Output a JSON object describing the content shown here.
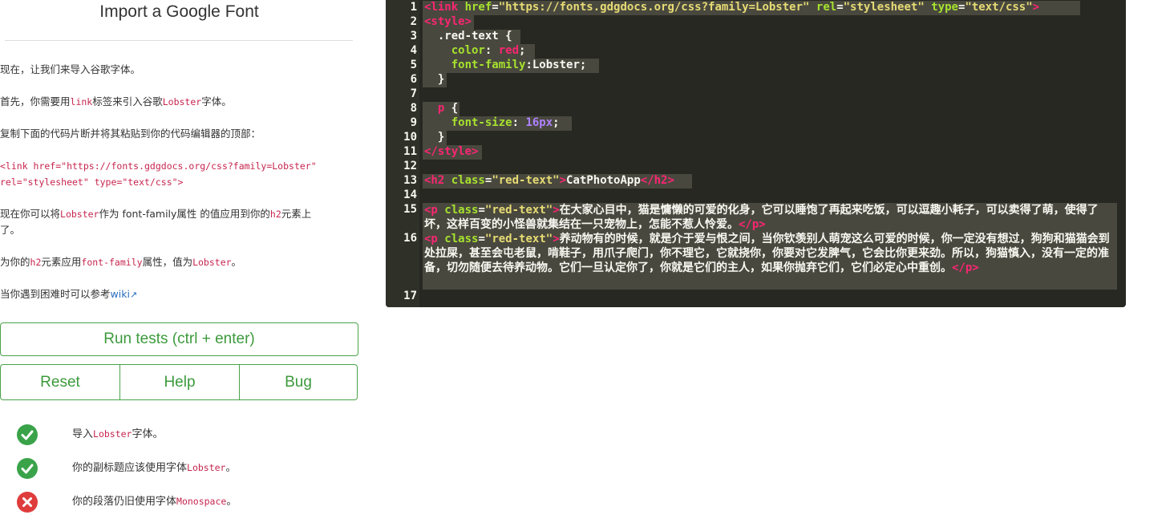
{
  "challenge": {
    "title": "Import a Google Font",
    "p1": "现在，让我们来导入谷歌字体。",
    "p2_a": "首先，你需要用",
    "p2_code1": "link",
    "p2_b": "标签来引入谷歌",
    "p2_code2": "Lobster",
    "p2_c": "字体。",
    "p3": "复制下面的代码片断并将其粘贴到你的代码编辑器的顶部：",
    "snippet_1": "<link href=\"https://fonts.gdgdocs.org/css?family=Lobster\"",
    "snippet_2": "rel=\"stylesheet\" type=\"text/css\">",
    "p4_a": "现在你可以将",
    "p4_code1": "Lobster",
    "p4_b": "作为 font-family属性 的值应用到你的",
    "p4_code2": "h2",
    "p4_c": "元素上",
    "p4_d": "了。",
    "p5_a": "为你的",
    "p5_code1": "h2",
    "p5_b": "元素应用",
    "p5_code2": "font-family",
    "p5_c": "属性，值为",
    "p5_code3": "Lobster",
    "p5_d": "。",
    "p6_a": "当你遇到困难时可以参考",
    "p6_link": "wiki"
  },
  "buttons": {
    "run": "Run tests (ctrl + enter)",
    "reset": "Reset",
    "help": "Help",
    "bug": "Bug"
  },
  "tests": [
    {
      "status": "pass",
      "a": "导入",
      "code": "Lobster",
      "b": "字体。"
    },
    {
      "status": "pass",
      "a": "你的副标题应该使用字体",
      "code": "Lobster",
      "b": "。"
    },
    {
      "status": "fail",
      "a": "你的段落仍旧使用字体",
      "code": "Monospace",
      "b": "。"
    }
  ],
  "editor": {
    "line_numbers": [
      "1",
      "2",
      "3",
      "4",
      "5",
      "6",
      "7",
      "8",
      "9",
      "10",
      "11",
      "12",
      "13",
      "14",
      "15",
      "16",
      "17"
    ],
    "l1": {
      "t1": "<link ",
      "a1": "href",
      "e1": "=",
      "s1": "\"https://fonts.gdgdocs.org/css?family=Lobster\"",
      "a2": " rel",
      "e2": "=",
      "s2": "\"stylesheet\"",
      "a3": " type",
      "e3": "=",
      "s3": "\"text/css\"",
      "t2": ">"
    },
    "l2": "<style>",
    "l3": "  .red-text {",
    "l4": {
      "prop": "    color",
      "sep": ": ",
      "val": "red",
      "end": ";"
    },
    "l5": {
      "prop": "    font-family",
      "sep": ":",
      "val": "Lobster;"
    },
    "l6": "  }",
    "l8": {
      "sel": "  p",
      "rest": " {"
    },
    "l9": {
      "prop": "    font-size",
      "sep": ": ",
      "val": "16px",
      "end": ";"
    },
    "l10": "  }",
    "l11": "</style>",
    "l13": {
      "t1": "<h2 ",
      "a1": "class",
      "e1": "=",
      "s1": "\"red-text\"",
      "t2": ">",
      "text": "CatPhotoApp",
      "t3": "</h2>"
    },
    "l15": {
      "t1": "<p ",
      "a1": "class",
      "e1": "=",
      "s1": "\"red-text\"",
      "t2": ">",
      "text": "在大家心目中，猫是慵懒的可爱的化身，它可以睡饱了再起来吃饭，可以逗趣小耗子，可以卖得了萌，使得了坏，这样百变的小怪兽就集结在一只宠物上，怎能不惹人怜爱。",
      "t3": "</p>"
    },
    "l16": {
      "t1": "<p ",
      "a1": "class",
      "e1": "=",
      "s1": "\"red-text\"",
      "t2": ">",
      "text": "养动物有的时候，就是介于爱与恨之间，当你钦羡别人萌宠这么可爱的时候，你一定没有想过，狗狗和猫猫会到处拉屎，甚至会屯老鼠，啃鞋子，用爪子爬门，你不理它，它就挠你，你要对它发脾气，它会比你更来劲。所以，狗猫慎入，没有一定的准备，切勿随便去待养动物。它们一旦认定你了，你就是它们的主人，如果你抛弃它们，它们必定心中重创。",
      "t3": "</p>"
    }
  },
  "colors": {
    "pass": "#3aa34a",
    "fail": "#df3c3c",
    "button": "#3c9a3c",
    "editor_bg": "#272822"
  }
}
